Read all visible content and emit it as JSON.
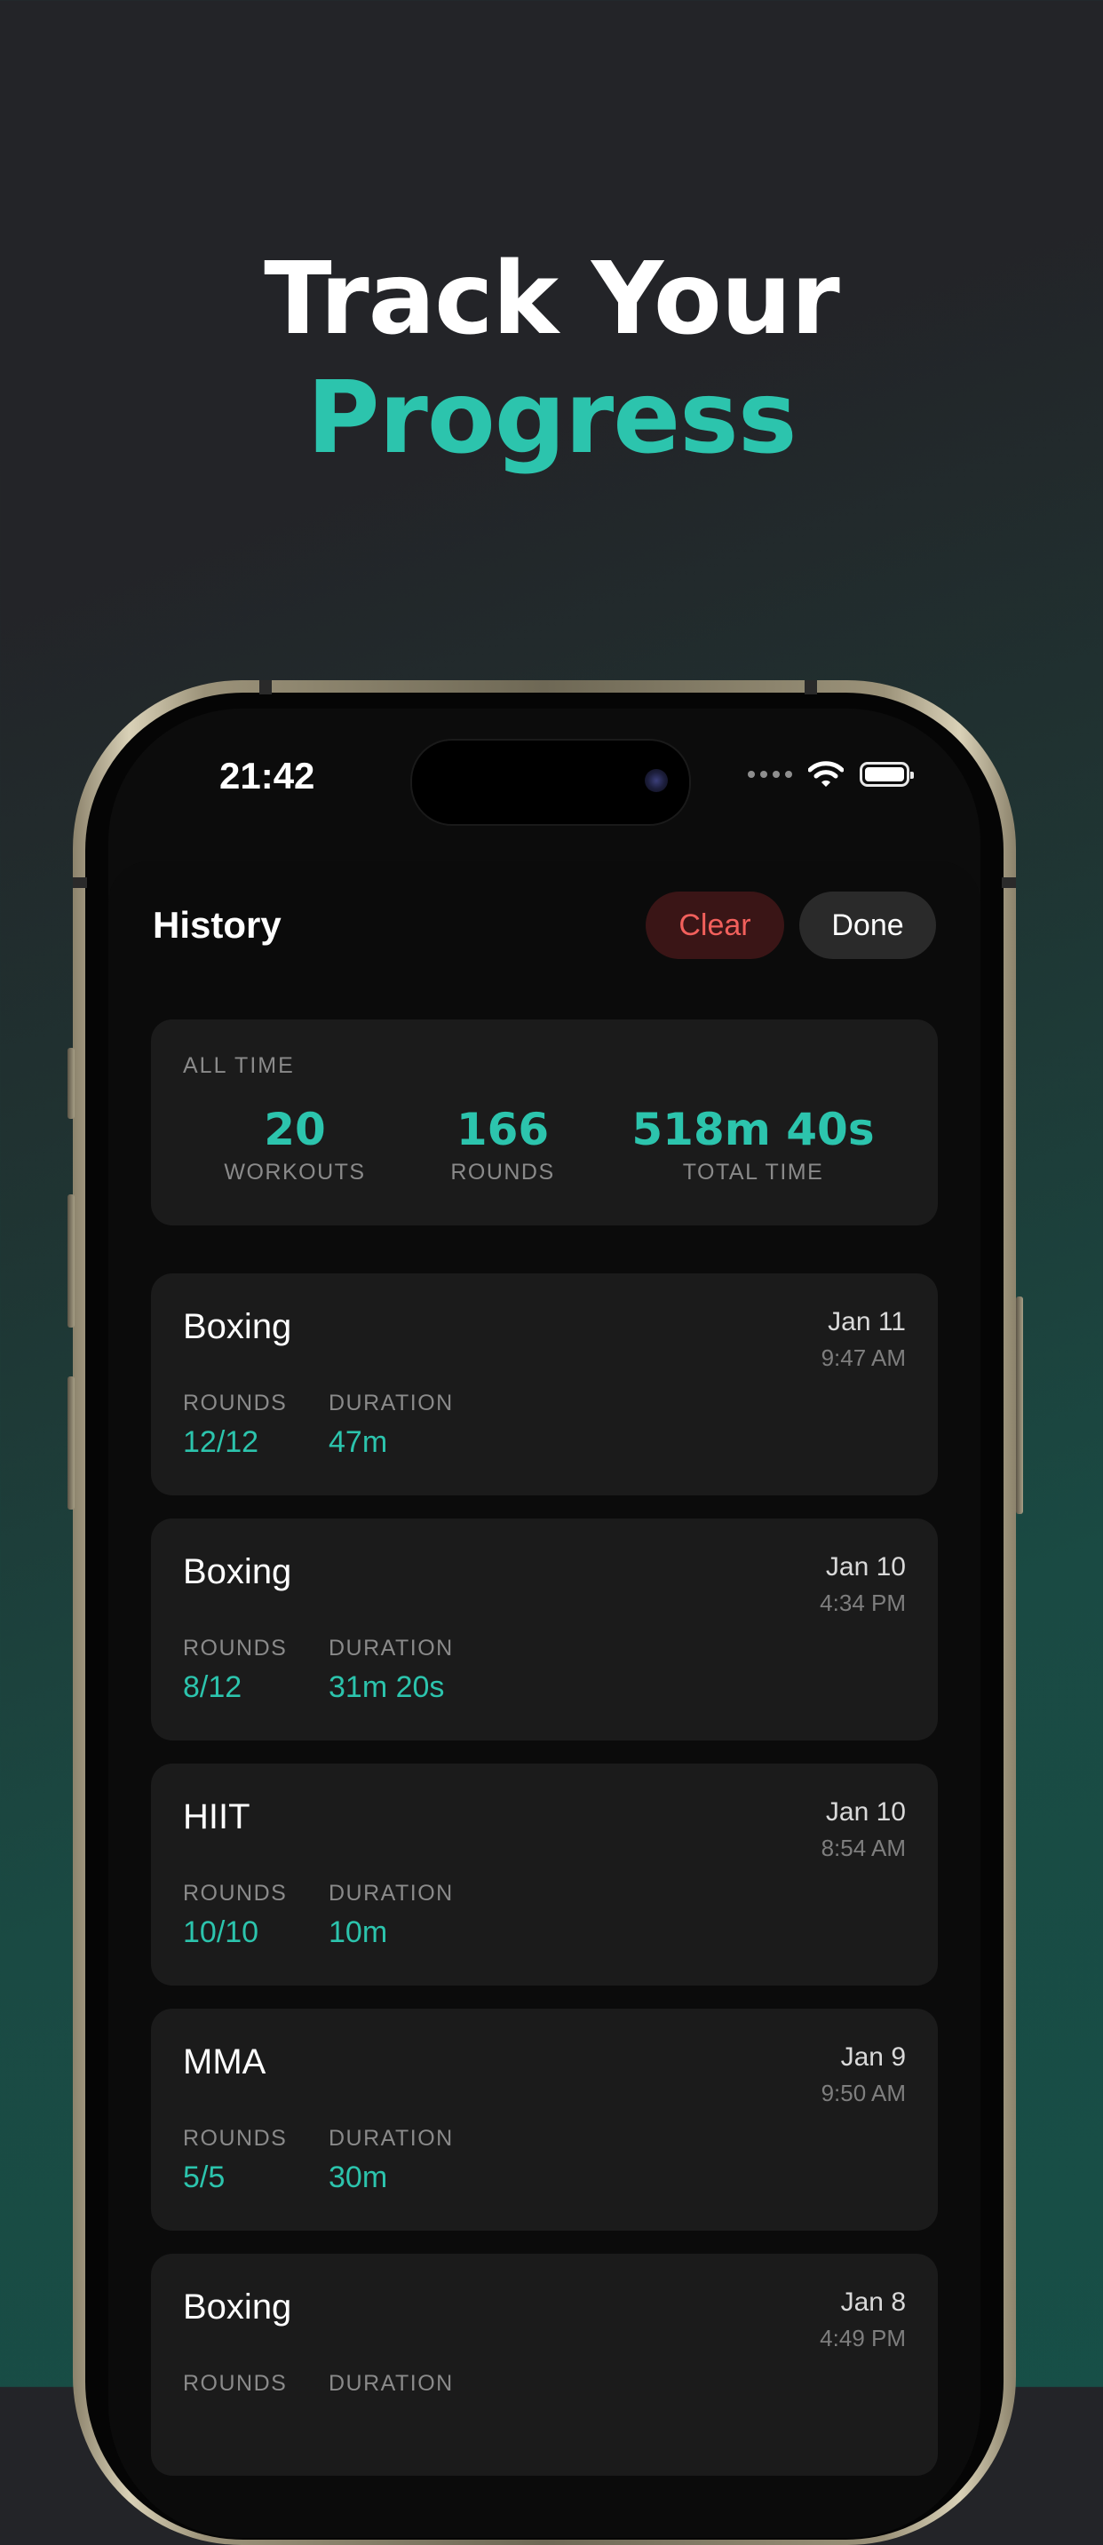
{
  "headline": {
    "line1": "Track Your",
    "line2": "Progress"
  },
  "status_bar": {
    "time": "21:42",
    "icons": [
      "signal-dots-icon",
      "wifi-icon",
      "battery-icon"
    ]
  },
  "sheet": {
    "title": "History",
    "clear_label": "Clear",
    "done_label": "Done"
  },
  "summary": {
    "label": "ALL TIME",
    "stats": [
      {
        "value": "20",
        "label": "WORKOUTS"
      },
      {
        "value": "166",
        "label": "ROUNDS"
      },
      {
        "value": "518m 40s",
        "label": "TOTAL TIME"
      }
    ]
  },
  "sessions": [
    {
      "name": "Boxing",
      "date": "Jan 11",
      "time": "9:47 AM",
      "rounds_label": "ROUNDS",
      "rounds": "12/12",
      "duration_label": "DURATION",
      "duration": "47m"
    },
    {
      "name": "Boxing",
      "date": "Jan 10",
      "time": "4:34 PM",
      "rounds_label": "ROUNDS",
      "rounds": "8/12",
      "duration_label": "DURATION",
      "duration": "31m 20s"
    },
    {
      "name": "HIIT",
      "date": "Jan 10",
      "time": "8:54 AM",
      "rounds_label": "ROUNDS",
      "rounds": "10/10",
      "duration_label": "DURATION",
      "duration": "10m"
    },
    {
      "name": "MMA",
      "date": "Jan 9",
      "time": "9:50 AM",
      "rounds_label": "ROUNDS",
      "rounds": "5/5",
      "duration_label": "DURATION",
      "duration": "30m"
    },
    {
      "name": "Boxing",
      "date": "Jan 8",
      "time": "4:49 PM",
      "rounds_label": "ROUNDS",
      "rounds": "",
      "duration_label": "DURATION",
      "duration": ""
    }
  ],
  "colors": {
    "accent": "#2cc4ad",
    "clear": "#f2605c",
    "card": "#1b1b1b",
    "sheet": "#0b0b0b"
  }
}
